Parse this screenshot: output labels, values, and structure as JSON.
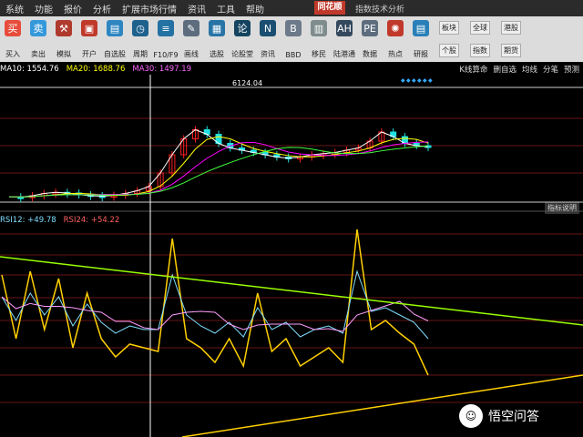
{
  "menubar": {
    "items": [
      "系统",
      "功能",
      "报价",
      "分析",
      "扩展市场行情",
      "资讯",
      "工具",
      "帮助"
    ],
    "app_logo": "同花顺",
    "window_title": "指数技术分析"
  },
  "toolbar": {
    "buttons": [
      {
        "label": "买入",
        "icon": "buy-icon",
        "color": "#e74c3c",
        "glyph": "买"
      },
      {
        "label": "卖出",
        "icon": "sell-icon",
        "color": "#3498db",
        "glyph": "卖"
      },
      {
        "label": "模拟",
        "icon": "hammer-icon",
        "color": "#b03a2e",
        "glyph": "⚒"
      },
      {
        "label": "开户",
        "icon": "briefcase-icon",
        "color": "#c0392b",
        "glyph": "▣"
      },
      {
        "label": "自选股",
        "icon": "screen-icon",
        "color": "#2e86c1",
        "glyph": "▤"
      },
      {
        "label": "周期",
        "icon": "clock-icon",
        "color": "#1f618d",
        "glyph": "◷"
      },
      {
        "label": "F10/F9",
        "icon": "doc-icon",
        "color": "#2471a3",
        "glyph": "≡"
      },
      {
        "label": "画线",
        "icon": "pen-icon",
        "color": "#5d6d7e",
        "glyph": "✎"
      },
      {
        "label": "选股",
        "icon": "window-icon",
        "color": "#2874a6",
        "glyph": "▦"
      },
      {
        "label": "论股堂",
        "icon": "chat-icon",
        "color": "#154360",
        "glyph": "论"
      },
      {
        "label": "资讯",
        "icon": "news-icon",
        "color": "#1b4f72",
        "glyph": "N"
      },
      {
        "label": "BBD",
        "icon": "bbd-icon",
        "color": "#6c7a89",
        "glyph": "B"
      },
      {
        "label": "移民",
        "icon": "grid-icon",
        "color": "#7f8c8d",
        "glyph": "▥"
      },
      {
        "label": "陆港通",
        "icon": "ah-icon",
        "color": "#34495e",
        "glyph": "AH"
      },
      {
        "label": "数据",
        "icon": "data-icon",
        "color": "#5d6d7e",
        "glyph": "PE"
      },
      {
        "label": "热点",
        "icon": "hot-icon",
        "color": "#c0392b",
        "glyph": "✺"
      },
      {
        "label": "研报",
        "icon": "report-icon",
        "color": "#2980b9",
        "glyph": "▤"
      }
    ],
    "grid_buttons": [
      [
        "板块",
        "个股"
      ],
      [
        "全球",
        "指数"
      ],
      [
        "港股",
        "期货"
      ]
    ]
  },
  "ma_header": {
    "ma10": "MA10: 1554.76",
    "ma20": "MA20: 1688.76",
    "ma30": "MA30: 1497.19"
  },
  "right_tabs": [
    "K线算命",
    "删自选",
    "均线",
    "分笔",
    "预测"
  ],
  "peak_label": "6124.04",
  "rsi_header": {
    "rsi12": "RSI12: +49.78",
    "rsi24": "RSI24: +54.22"
  },
  "rsi_help": "指标说明",
  "watermark": "悟空问答",
  "colors": {
    "ma10": "#ffffff",
    "ma20": "#ffff00",
    "ma30": "#ff00ff",
    "rsi12": "#7fdfff",
    "rsi24": "#ff4040",
    "up_candle": "#ff2020",
    "down_candle": "#20e0e0"
  },
  "chart_data": [
    {
      "type": "line",
      "series": [
        {
          "name": "MA10",
          "values": [
            1554,
            1540,
            1600,
            1700,
            1750,
            1720,
            1650,
            1600,
            1580,
            1620,
            1700,
            1820,
            2000,
            2600,
            3400,
            4100,
            4500,
            4300,
            3900,
            3700,
            3600,
            3500,
            3400,
            3300,
            3250,
            3300,
            3400,
            3450,
            3500,
            3600,
            3700,
            4000,
            4400,
            4200,
            3900,
            3800,
            3750
          ]
        }
      ]
    },
    {
      "type": "line",
      "series": [
        {
          "name": "RSI12",
          "values": [
            70,
            35,
            72,
            40,
            68,
            30,
            60,
            35,
            25,
            32,
            30,
            28,
            90,
            35,
            30,
            22,
            35,
            20,
            60,
            28,
            35,
            20,
            25,
            30,
            22,
            95,
            40,
            45,
            38,
            32,
            15
          ]
        },
        {
          "name": "RSI24",
          "values": [
            58,
            45,
            60,
            48,
            58,
            42,
            54,
            44,
            38,
            42,
            40,
            40,
            70,
            48,
            42,
            38,
            44,
            36,
            52,
            40,
            44,
            36,
            40,
            42,
            38,
            72,
            50,
            52,
            48,
            44,
            35
          ]
        }
      ]
    }
  ]
}
